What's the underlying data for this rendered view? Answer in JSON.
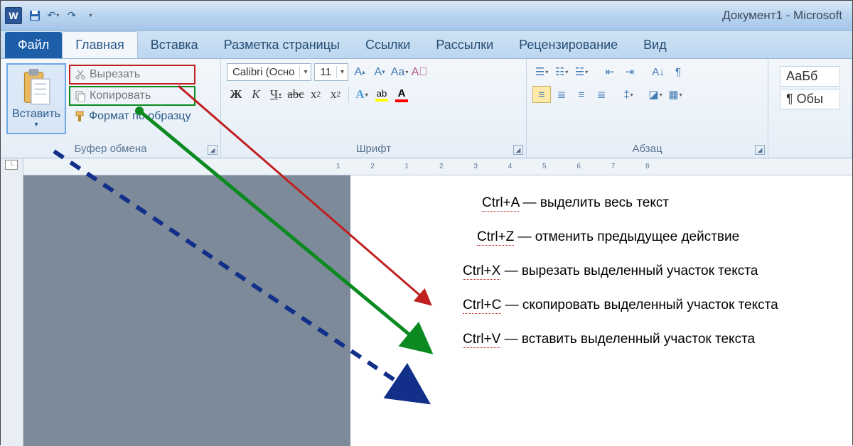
{
  "title": "Документ1 - Microsoft",
  "tabs": {
    "file": "Файл",
    "home": "Главная",
    "insert": "Вставка",
    "layout": "Разметка страницы",
    "refs": "Ссылки",
    "mail": "Рассылки",
    "review": "Рецензирование",
    "view": "Вид"
  },
  "clipboard": {
    "paste": "Вставить",
    "cut": "Вырезать",
    "copy": "Копировать",
    "format": "Формат по образцу",
    "title": "Буфер обмена"
  },
  "font": {
    "name": "Calibri (Осно",
    "size": "11",
    "title": "Шрифт"
  },
  "para": {
    "title": "Абзац"
  },
  "styles": {
    "s1": "АаБб",
    "s2": "¶ Обы"
  },
  "ruler": "1    2    1    2    3    4    5    6    7    8",
  "doc": {
    "l1k": "Ctrl+A",
    "l1t": " — выделить весь текст",
    "l2k": "Ctrl+Z",
    "l2t": " — отменить предыдущее действие",
    "l3k": "Ctrl+X",
    "l3t": " — вырезать выделенный участок текста",
    "l4k": "Ctrl+C",
    "l4t": " — скопировать выделенный участок текста",
    "l5k": "Ctrl+V",
    "l5t": " — вставить выделенный участок текста"
  }
}
